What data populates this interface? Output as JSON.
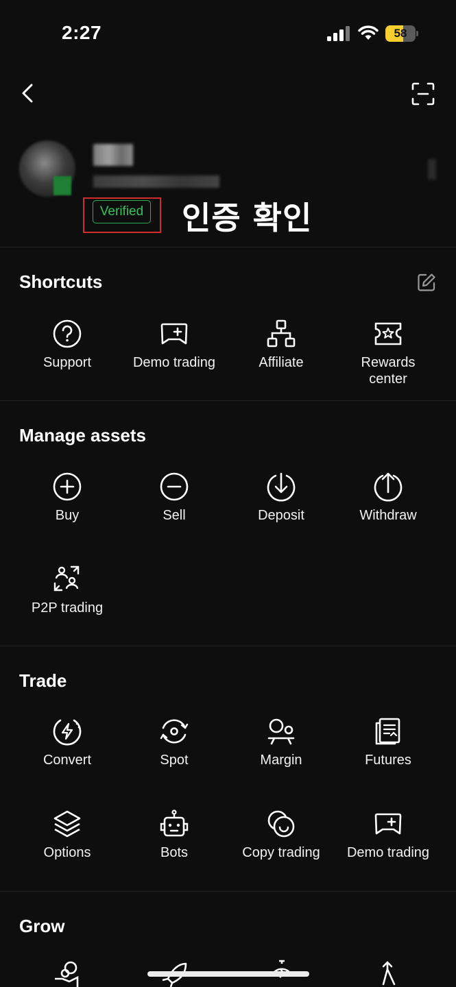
{
  "status_bar": {
    "time": "2:27",
    "battery_percent": 58,
    "battery_label": "58",
    "battery_color": "#f6cf2e"
  },
  "nav": {
    "back_icon": "chevron-left-icon",
    "scan_icon": "scan-icon"
  },
  "profile": {
    "verified_label": "Verified",
    "verified_color": "#35c25c",
    "annotation": "인증 확인",
    "annotation_box_color": "#d12b2b"
  },
  "shortcuts": {
    "title": "Shortcuts",
    "edit_icon": "edit-icon",
    "items": [
      {
        "label": "Support",
        "icon": "question-circle-icon"
      },
      {
        "label": "Demo trading",
        "icon": "gamepad-icon"
      },
      {
        "label": "Affiliate",
        "icon": "network-icon"
      },
      {
        "label": "Rewards\ncenter",
        "icon": "ticket-star-icon"
      }
    ]
  },
  "manage_assets": {
    "title": "Manage assets",
    "items": [
      {
        "label": "Buy",
        "icon": "plus-circle-icon"
      },
      {
        "label": "Sell",
        "icon": "minus-circle-icon"
      },
      {
        "label": "Deposit",
        "icon": "arrow-down-circle-icon"
      },
      {
        "label": "Withdraw",
        "icon": "arrow-up-circle-icon"
      },
      {
        "label": "P2P trading",
        "icon": "p2p-users-icon"
      }
    ]
  },
  "trade": {
    "title": "Trade",
    "items": [
      {
        "label": "Convert",
        "icon": "lightning-circle-icon"
      },
      {
        "label": "Spot",
        "icon": "spot-circle-icon"
      },
      {
        "label": "Margin",
        "icon": "margin-icon"
      },
      {
        "label": "Futures",
        "icon": "futures-document-icon"
      },
      {
        "label": "Options",
        "icon": "layers-icon"
      },
      {
        "label": "Bots",
        "icon": "robot-icon"
      },
      {
        "label": "Copy trading",
        "icon": "copy-trading-icon"
      },
      {
        "label": "Demo trading",
        "icon": "gamepad-icon"
      }
    ]
  },
  "grow": {
    "title": "Grow"
  }
}
